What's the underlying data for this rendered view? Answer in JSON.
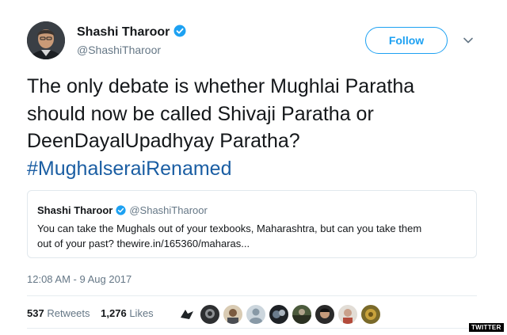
{
  "author": {
    "name": "Shashi Tharoor",
    "handle": "@ShashiTharoor",
    "avatar_icon": "profile-photo",
    "verified_icon": "verified-badge-icon"
  },
  "follow_button": {
    "label": "Follow"
  },
  "menu_icon": "chevron-down-icon",
  "tweet": {
    "lines": [
      "The only debate is whether Mughlai Paratha",
      "should now be called Shivaji Paratha or",
      "DeenDayalUpadhyay Paratha?"
    ],
    "hashtag": "#MughalseraiRenamed"
  },
  "quoted_tweet": {
    "name": "Shashi Tharoor",
    "handle": "@ShashiTharoor",
    "lines": [
      "You can take the Mughals out of your texbooks, Maharashtra, but can you take them",
      "out of your past? thewire.in/165360/maharas..."
    ]
  },
  "timestamp": "12:08 AM - 9 Aug 2017",
  "stats": {
    "retweets_count": "537",
    "retweets_label": "Retweets",
    "likes_count": "1,276",
    "likes_label": "Likes"
  },
  "likers_count_shown": 9,
  "watermark": "TWITTER",
  "colors": {
    "accent": "#1da1f2",
    "hashtag": "#1b5ea3",
    "secondary_text": "#657786",
    "border": "#e1e8ed"
  }
}
